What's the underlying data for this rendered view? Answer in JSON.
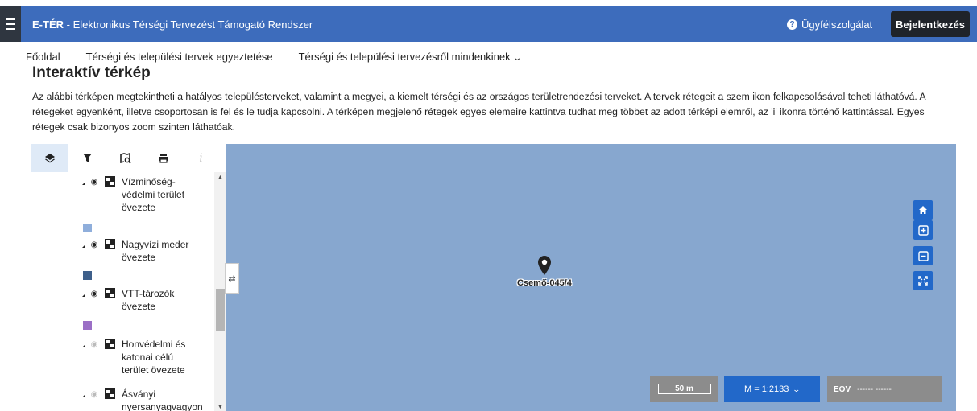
{
  "header": {
    "brand": "E-TÉR",
    "separator": " - ",
    "title": "Elektronikus Térségi Tervezést Támogató Rendszer",
    "help_label": "Ügyfélszolgálat",
    "help_icon": "question-circle-icon",
    "login_label": "Bejelentkezés",
    "bar_color": "#3d6cbc"
  },
  "nav": {
    "items": [
      {
        "label": "Főoldal"
      },
      {
        "label": "Térségi és települési tervek egyeztetése"
      },
      {
        "label": "Térségi és települési tervezésről mindenkinek"
      }
    ]
  },
  "page": {
    "title": "Interaktív térkép",
    "intro": "Az alábbi térképen megtekintheti a hatályos településterveket, valamint a megyei, a kiemelt térségi és az országos területrendezési terveket. A tervek rétegeit a szem ikon felkapcsolásával teheti láthatóvá. A rétegeket egyenként, illetve csoportosan is fel és le tudja kapcsolni. A térképen megjelenő rétegek egyes elemeire kattintva tudhat meg többet az adott térképi elemről, az 'i' ikonra történő kattintással. Egyes rétegek csak bizonyos zoom szinten láthatóak."
  },
  "panel": {
    "tabs": [
      {
        "icon": "layers-icon",
        "active": true
      },
      {
        "icon": "filter-icon",
        "active": false
      },
      {
        "icon": "map-search-icon",
        "active": false
      },
      {
        "icon": "print-icon",
        "active": false
      },
      {
        "icon": "info-icon",
        "active": false,
        "disabled": true
      }
    ],
    "layers": [
      {
        "name": "Vízminőség-védelmi terület övezete",
        "visible": true,
        "swatch": "#8faedb"
      },
      {
        "name": "Nagyvízi meder övezete",
        "visible": true,
        "swatch": "#3e5f8a"
      },
      {
        "name": "VTT-tározók övezete",
        "visible": true,
        "swatch": "#9b6fc6"
      },
      {
        "name": "Honvédelmi és katonai célú terület övezete",
        "visible": false
      },
      {
        "name": "Ásványi nyersanyagvagyon",
        "visible": false
      }
    ]
  },
  "map": {
    "background": "#87a7cf",
    "marker_label": "Csemő-045/4",
    "controls": [
      "home-icon",
      "zoom-in-icon",
      "zoom-out-icon",
      "fullscreen-icon"
    ],
    "scale_label": "50 m",
    "zoom_label": "M = 1:2133",
    "coord_label": "EOV",
    "coord_value": "------ ------"
  }
}
